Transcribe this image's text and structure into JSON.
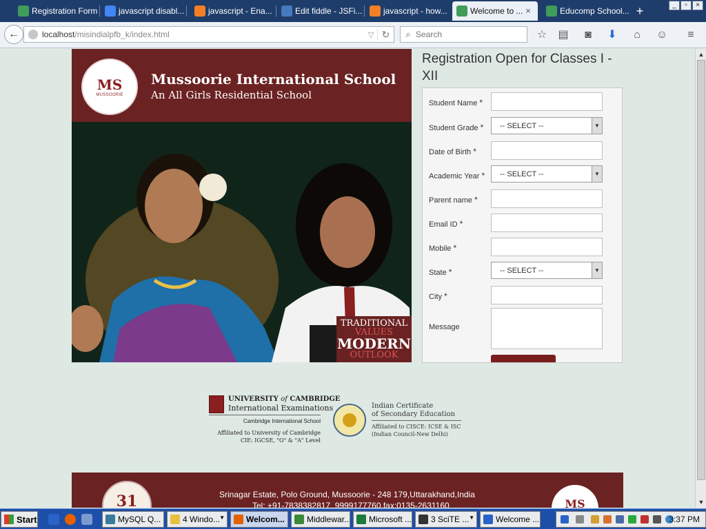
{
  "browser": {
    "tabs": [
      {
        "title": "Registration Form",
        "icon": "document-icon",
        "color": "#3f9c5a"
      },
      {
        "title": "javascript disabl...",
        "icon": "google-icon",
        "color": "#4285f4"
      },
      {
        "title": "javascript - Ena...",
        "icon": "stackoverflow-icon",
        "color": "#f48024"
      },
      {
        "title": "Edit fiddle - JSFi...",
        "icon": "jsfiddle-icon",
        "color": "#4679bd"
      },
      {
        "title": "javascript - how...",
        "icon": "stackoverflow-icon",
        "color": "#f48024"
      },
      {
        "title": "Welcome to ...",
        "icon": "document-icon",
        "color": "#3f9c5a",
        "active": true
      },
      {
        "title": "Educomp School...",
        "icon": "document-icon",
        "color": "#3f9c5a"
      }
    ],
    "url_host": "localhost",
    "url_path": "/misindialpfb_k/index.html",
    "search_placeholder": "Search"
  },
  "banner": {
    "school_name": "Mussoorie International School",
    "school_tagline": "An All Girls Residential School",
    "logo_text": "MS",
    "logo_sub": "MUSSOORIE",
    "slogan": [
      "TRADITIONAL",
      "VALUES",
      "MODERN",
      "OUTLOOK"
    ]
  },
  "form": {
    "title": "Registration Open for Classes I - XII",
    "required_mark": "*",
    "fields": [
      {
        "label": "Student Name",
        "required": true,
        "type": "text",
        "value": ""
      },
      {
        "label": "Student Grade",
        "required": true,
        "type": "select",
        "value": "-- SELECT --"
      },
      {
        "label": "Date of Birth",
        "required": true,
        "type": "text",
        "value": ""
      },
      {
        "label": "Academic Year",
        "required": true,
        "type": "select",
        "value": "-- SELECT --"
      },
      {
        "label": "Parent name",
        "required": true,
        "type": "text",
        "value": ""
      },
      {
        "label": "Email ID",
        "required": true,
        "type": "text",
        "value": ""
      },
      {
        "label": "Mobile",
        "required": true,
        "type": "text",
        "value": ""
      },
      {
        "label": "State",
        "required": true,
        "type": "select",
        "value": "-- SELECT --"
      },
      {
        "label": "City",
        "required": true,
        "type": "text",
        "value": ""
      },
      {
        "label": "Message",
        "required": false,
        "type": "textarea",
        "value": ""
      }
    ]
  },
  "affiliations": {
    "cambridge": {
      "name_part1": "UNIVERSITY",
      "name_of": "of",
      "name_part2": "CAMBRIDGE",
      "line2": "International Examinations",
      "line3": "Cambridge International School",
      "line4": "Affiliated to University of Cambridge",
      "line5": "CIE: IGCSE, \"O\" & \"A\" Level"
    },
    "icse": {
      "line1": "Indian Certificate",
      "line2": "of Secondary Education",
      "line3": "Affiliated to CISCE: ICSE & ISC",
      "line4": "(Indian Council-New Delhi)"
    }
  },
  "footer": {
    "address": "Srinagar Estate, Polo Ground, Mussoorie - 248 179,Uttarakhand,India",
    "phone": "Tel: +91-7838382817, 9999177760,fax:0135-2631160",
    "badge_number": "31",
    "logo_text": "MS"
  },
  "taskbar": {
    "start_label": "Start",
    "tasks": [
      {
        "label": "MySQL Q...",
        "color": "#3a7a9c"
      },
      {
        "label": "4 Windo...",
        "color": "#e8c040",
        "arrow": true
      },
      {
        "label": "Welcom...",
        "color": "#e66000",
        "active": true
      },
      {
        "label": "Middlewar...",
        "color": "#3a8a3a"
      },
      {
        "label": "Microsoft ...",
        "color": "#1d7a3a"
      },
      {
        "label": "3 SciTE ...",
        "color": "#333333",
        "arrow": true
      },
      {
        "label": "Welcome ...",
        "color": "#2a62c8"
      }
    ],
    "clock": "3:37 PM"
  },
  "colors": {
    "maroon": "#6b2222",
    "page_bg": "#dfe9e4",
    "tabbar": "#1f3d6b"
  }
}
